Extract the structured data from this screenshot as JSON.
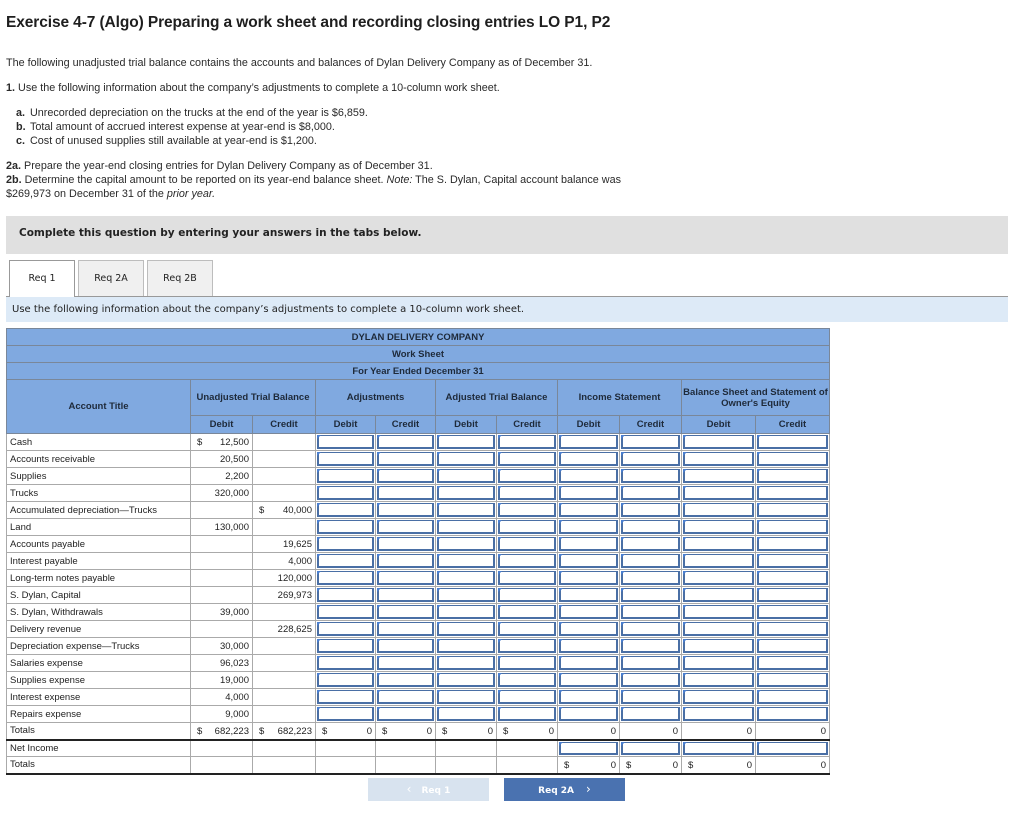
{
  "header": {
    "title": "Exercise 4-7 (Algo) Preparing a work sheet and recording closing entries LO P1, P2"
  },
  "problem": {
    "intro": "The following unadjusted trial balance contains the accounts and balances of Dylan Delivery Company as of December 31.",
    "q1_num": "1.",
    "q1_text": " Use the following information about the company’s adjustments to complete a 10-column work sheet.",
    "adjustments": [
      {
        "letter": "a.",
        "text": "Unrecorded depreciation on the trucks at the end of the year is $6,859."
      },
      {
        "letter": "b.",
        "text": "Total amount of accrued interest expense at year-end is $8,000."
      },
      {
        "letter": "c.",
        "text": "Cost of unused supplies still available at year-end is $1,200."
      }
    ],
    "q2a_num": "2a.",
    "q2a_text": " Prepare the year-end closing entries for Dylan Delivery Company as of December 31.",
    "q2b_num": "2b.",
    "q2b_text": " Determine the capital amount to be reported on its year-end balance sheet. ",
    "q2b_note_label": "Note:",
    "q2b_note_text": " The S. Dylan, Capital account balance was",
    "q2b_line2_a": "$269,973 on December 31 of the ",
    "q2b_line2_em": "prior year.",
    "q2b_line2_end": ""
  },
  "instructions_bar": "Complete this question by entering your answers in the tabs below.",
  "tabs": [
    {
      "label": "Req 1",
      "active": true
    },
    {
      "label": "Req 2A",
      "active": false
    },
    {
      "label": "Req 2B",
      "active": false
    }
  ],
  "tab_instruction": "Use the following information about the company’s adjustments to complete a 10-column work sheet.",
  "worksheet": {
    "company": "DYLAN DELIVERY COMPANY",
    "sheet_name": "Work Sheet",
    "period": "For Year Ended December 31",
    "account_title_header": "Account Title",
    "groups": [
      "Unadjusted Trial Balance",
      "Adjustments",
      "Adjusted Trial Balance",
      "Income Statement",
      "Balance Sheet  and Statement of Owner's Equity"
    ],
    "debit_label": "Debit",
    "credit_label": "Credit",
    "currency": "$",
    "rows": [
      {
        "account": "Cash",
        "debit": "12,500",
        "credit": "",
        "debit_dollar": true
      },
      {
        "account": "Accounts receivable",
        "debit": "20,500",
        "credit": ""
      },
      {
        "account": "Supplies",
        "debit": "2,200",
        "credit": ""
      },
      {
        "account": "Trucks",
        "debit": "320,000",
        "credit": ""
      },
      {
        "account": "Accumulated depreciation—Trucks",
        "debit": "",
        "credit": "40,000",
        "credit_dollar": true
      },
      {
        "account": "Land",
        "debit": "130,000",
        "credit": ""
      },
      {
        "account": "Accounts payable",
        "debit": "",
        "credit": "19,625"
      },
      {
        "account": "Interest payable",
        "debit": "",
        "credit": "4,000"
      },
      {
        "account": "Long-term notes payable",
        "debit": "",
        "credit": "120,000"
      },
      {
        "account": "S. Dylan, Capital",
        "debit": "",
        "credit": "269,973"
      },
      {
        "account": "S. Dylan, Withdrawals",
        "debit": "39,000",
        "credit": ""
      },
      {
        "account": "Delivery revenue",
        "debit": "",
        "credit": "228,625"
      },
      {
        "account": "Depreciation expense—Trucks",
        "debit": "30,000",
        "credit": ""
      },
      {
        "account": "Salaries expense",
        "debit": "96,023",
        "credit": ""
      },
      {
        "account": "Supplies expense",
        "debit": "19,000",
        "credit": ""
      },
      {
        "account": "Interest expense",
        "debit": "4,000",
        "credit": ""
      },
      {
        "account": "Repairs expense",
        "debit": "9,000",
        "credit": ""
      }
    ],
    "totals": {
      "label": "Totals",
      "unadjusted_debit": "682,223",
      "unadjusted_credit": "682,223",
      "adjustments_debit": "0",
      "adjustments_credit": "0",
      "adjusted_debit": "0",
      "adjusted_credit": "0",
      "is_debit": "0",
      "is_credit": "0",
      "bs_debit": "0",
      "bs_credit": "0"
    },
    "net_income_label": "Net Income",
    "final_totals": {
      "label": "Totals",
      "is_debit": "0",
      "is_credit": "0",
      "bs_debit": "0",
      "bs_credit": "0"
    }
  },
  "navigation": {
    "prev_label": "Req 1",
    "next_label": "Req 2A",
    "prev_icon": "‹",
    "next_icon": "›"
  }
}
